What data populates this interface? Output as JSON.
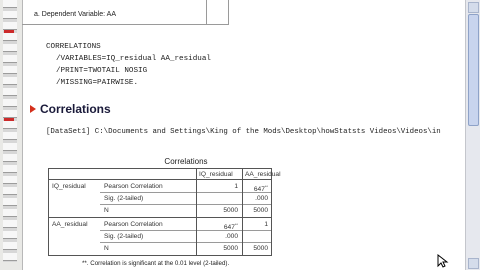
{
  "output": {
    "prev_table_footnote": "a. Dependent Variable: AA",
    "syntax_lines": [
      "CORRELATIONS",
      "/VARIABLES=IQ_residual AA_residual",
      "/PRINT=TWOTAIL NOSIG",
      "/MISSING=PAIRWISE."
    ],
    "section_title": "Correlations",
    "dataset_line": "[DataSet1] C:\\Documents and Settings\\King of the Mods\\Desktop\\howStatsts Videos\\Videos\\in"
  },
  "table": {
    "caption": "Correlations",
    "col_headers": [
      "IQ_residual",
      "AA_residual"
    ],
    "rows": [
      {
        "var": "IQ_residual",
        "stat": "Pearson Correlation",
        "c1": "1",
        "c2": "647",
        "c2_sup": "**"
      },
      {
        "var": "",
        "stat": "Sig. (2-tailed)",
        "c1": "",
        "c2": ".000",
        "c2_sup": ""
      },
      {
        "var": "",
        "stat": "N",
        "c1": "5000",
        "c2": "5000",
        "c2_sup": ""
      },
      {
        "var": "AA_residual",
        "stat": "Pearson Correlation",
        "c1": "647",
        "c1_sup": "**",
        "c2": "1",
        "c2_sup": ""
      },
      {
        "var": "",
        "stat": "Sig. (2-tailed)",
        "c1": ".000",
        "c1_sup": "",
        "c2": "",
        "c2_sup": ""
      },
      {
        "var": "",
        "stat": "N",
        "c1": "5000",
        "c1_sup": "",
        "c2": "5000",
        "c2_sup": ""
      }
    ],
    "footnote": "**. Correlation is significant at the 0.01 level (2-tailed)."
  },
  "colors": {
    "heading_arrow": "#d4301c",
    "heading_text": "#1a1a3a"
  }
}
